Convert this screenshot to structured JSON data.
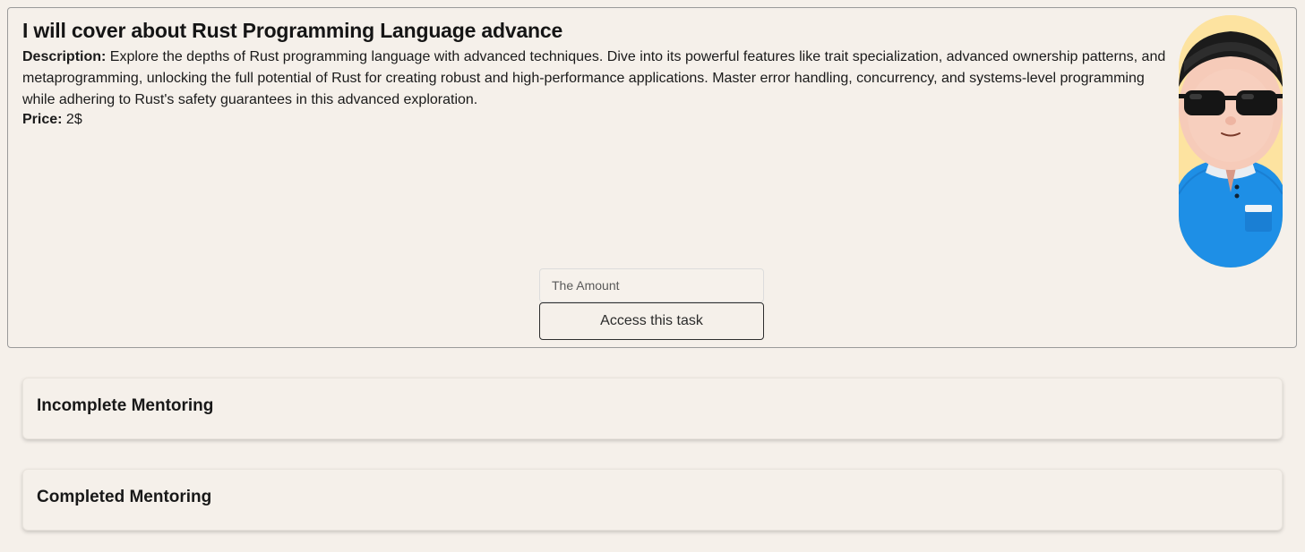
{
  "task": {
    "title": "I will cover about Rust Programming Language advance",
    "description_label": "Description:",
    "description": "Explore the depths of Rust programming language with advanced techniques. Dive into its powerful features like trait specialization, advanced ownership patterns, and metaprogramming, unlocking the full potential of Rust for creating robust and high-performance applications. Master error handling, concurrency, and systems-level programming while adhering to Rust's safety guarantees in this advanced exploration.",
    "price_label": "Price:",
    "price": "2$",
    "avatar": "mentor-avatar",
    "amount_placeholder": "The Amount",
    "access_button": "Access this task"
  },
  "sections": {
    "incomplete": "Incomplete Mentoring",
    "completed": "Completed Mentoring"
  },
  "colors": {
    "background": "#f5f0ea",
    "avatar_background": "#fde3a0",
    "shirt": "#1e90e8"
  }
}
